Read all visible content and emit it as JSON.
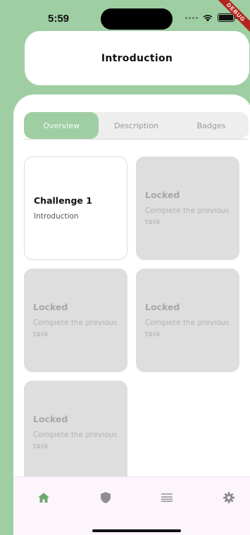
{
  "status_bar": {
    "time": "5:59"
  },
  "debug_banner": "DEBUG",
  "header": {
    "title": "Introduction"
  },
  "tabs": [
    {
      "label": "Overview",
      "active": true
    },
    {
      "label": "Description",
      "active": false
    },
    {
      "label": "Badges",
      "active": false
    }
  ],
  "challenges": [
    {
      "title": "Challenge 1",
      "subtitle": "Introduction",
      "locked": false
    },
    {
      "title": "Locked",
      "subtitle": "Complete the previous task",
      "locked": true
    },
    {
      "title": "Locked",
      "subtitle": "Complete the previous task",
      "locked": true
    },
    {
      "title": "Locked",
      "subtitle": "Complete the previous task",
      "locked": true
    },
    {
      "title": "Locked",
      "subtitle": "Complete the previous task",
      "locked": true
    }
  ],
  "nav": [
    {
      "icon": "home-icon",
      "active": true
    },
    {
      "icon": "shield-icon",
      "active": false
    },
    {
      "icon": "list-icon",
      "active": false
    },
    {
      "icon": "gear-icon",
      "active": false
    }
  ],
  "colors": {
    "accent": "#9fcea3",
    "nav_active": "#6aa86f",
    "nav_inactive": "#9a9a9a",
    "locked_card": "#dedede",
    "nav_background": "#fcf5fc"
  }
}
